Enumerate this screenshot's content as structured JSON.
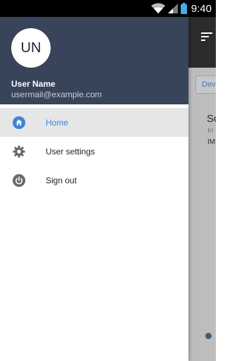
{
  "status_bar": {
    "time": "9:40"
  },
  "drawer": {
    "avatar_initials": "UN",
    "user_name": "User Name",
    "user_email": "usermail@example.com",
    "nav_items": [
      {
        "label": "Home",
        "icon": "home-icon",
        "active": true
      },
      {
        "label": "User settings",
        "icon": "gear-icon",
        "active": false
      },
      {
        "label": "Sign out",
        "icon": "power-icon",
        "active": false
      }
    ]
  },
  "background_app": {
    "chip_label": "Dev",
    "card_title": "Sc",
    "card_subtitle": "In",
    "card_tag": "IM"
  },
  "colors": {
    "header_bg": "#374459",
    "accent": "#3a86d8",
    "active_item_bg": "#e6e6e6"
  }
}
